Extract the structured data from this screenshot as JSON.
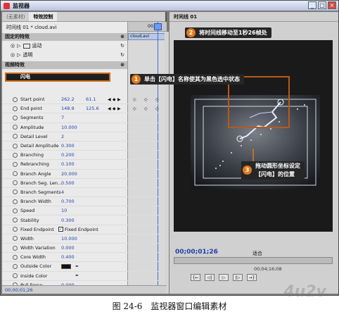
{
  "window": {
    "title": "监视器"
  },
  "left_panel": {
    "tabs": [
      "(无素材)",
      "特效控制"
    ],
    "source": "时间线 01 * cloud.avi",
    "mini_timeline": {
      "ruler": "00;0",
      "clip": "cloud.avi"
    },
    "sections": {
      "fixed": "固定的特效",
      "motion": "运动",
      "opacity": "透明",
      "video": "视频特效",
      "effect": "闪电"
    },
    "params": [
      {
        "name": "Start point",
        "v1": "262.2",
        "v2": "61.1"
      },
      {
        "name": "End point",
        "v1": "148.9",
        "v2": "125.6"
      },
      {
        "name": "Segments",
        "v1": "7"
      },
      {
        "name": "Amplitude",
        "v1": "10.000"
      },
      {
        "name": "Detail Level",
        "v1": "2"
      },
      {
        "name": "Detail Amplitude",
        "v1": "0.300"
      },
      {
        "name": "Branching",
        "v1": "0.200"
      },
      {
        "name": "Rebranching",
        "v1": "0.100"
      },
      {
        "name": "Branch Angle",
        "v1": "20.000"
      },
      {
        "name": "Branch Seg. Len...",
        "v1": "0.500"
      },
      {
        "name": "Branch Segments",
        "v1": "4"
      },
      {
        "name": "Branch Width",
        "v1": "0.700"
      },
      {
        "name": "Speed",
        "v1": "10"
      },
      {
        "name": "Stability",
        "v1": "0.300"
      },
      {
        "name": "Fixed Endpoint",
        "v1": "Fixed Endpoint"
      },
      {
        "name": "Width",
        "v1": "10.000"
      },
      {
        "name": "Width Variation",
        "v1": "0.000"
      },
      {
        "name": "Core Width",
        "v1": "0.400"
      },
      {
        "name": "Outside Color",
        "v1": ""
      },
      {
        "name": "Inside Color",
        "v1": ""
      },
      {
        "name": "Pull Force",
        "v1": "0.000"
      }
    ],
    "bottom_time": "00;00;01;26"
  },
  "right_panel": {
    "tab": "时间线 01",
    "timecode": "00;00;01;26",
    "fit": "适合",
    "timecode2": "00;04;16;08",
    "transport": [
      "{←",
      "◁|",
      "▷",
      "|▷",
      "→}"
    ]
  },
  "callouts": {
    "c1": "单击【闪电】名称使其为黑色选中状态",
    "c2": "将时间线移动至1秒26帧处",
    "c3_line1": "拖动圆形坐标设定",
    "c3_line2": "【闪电】的位置"
  },
  "callout_numbers": {
    "n1": "1",
    "n2": "2",
    "n3": "3"
  },
  "caption": "图 24-6　监视器窗口编辑素材",
  "watermark": "4u2v",
  "colors": {
    "accent_orange": "#e07a1c",
    "value_blue": "#1f3fa8",
    "selection_border": "#c86a1a"
  }
}
